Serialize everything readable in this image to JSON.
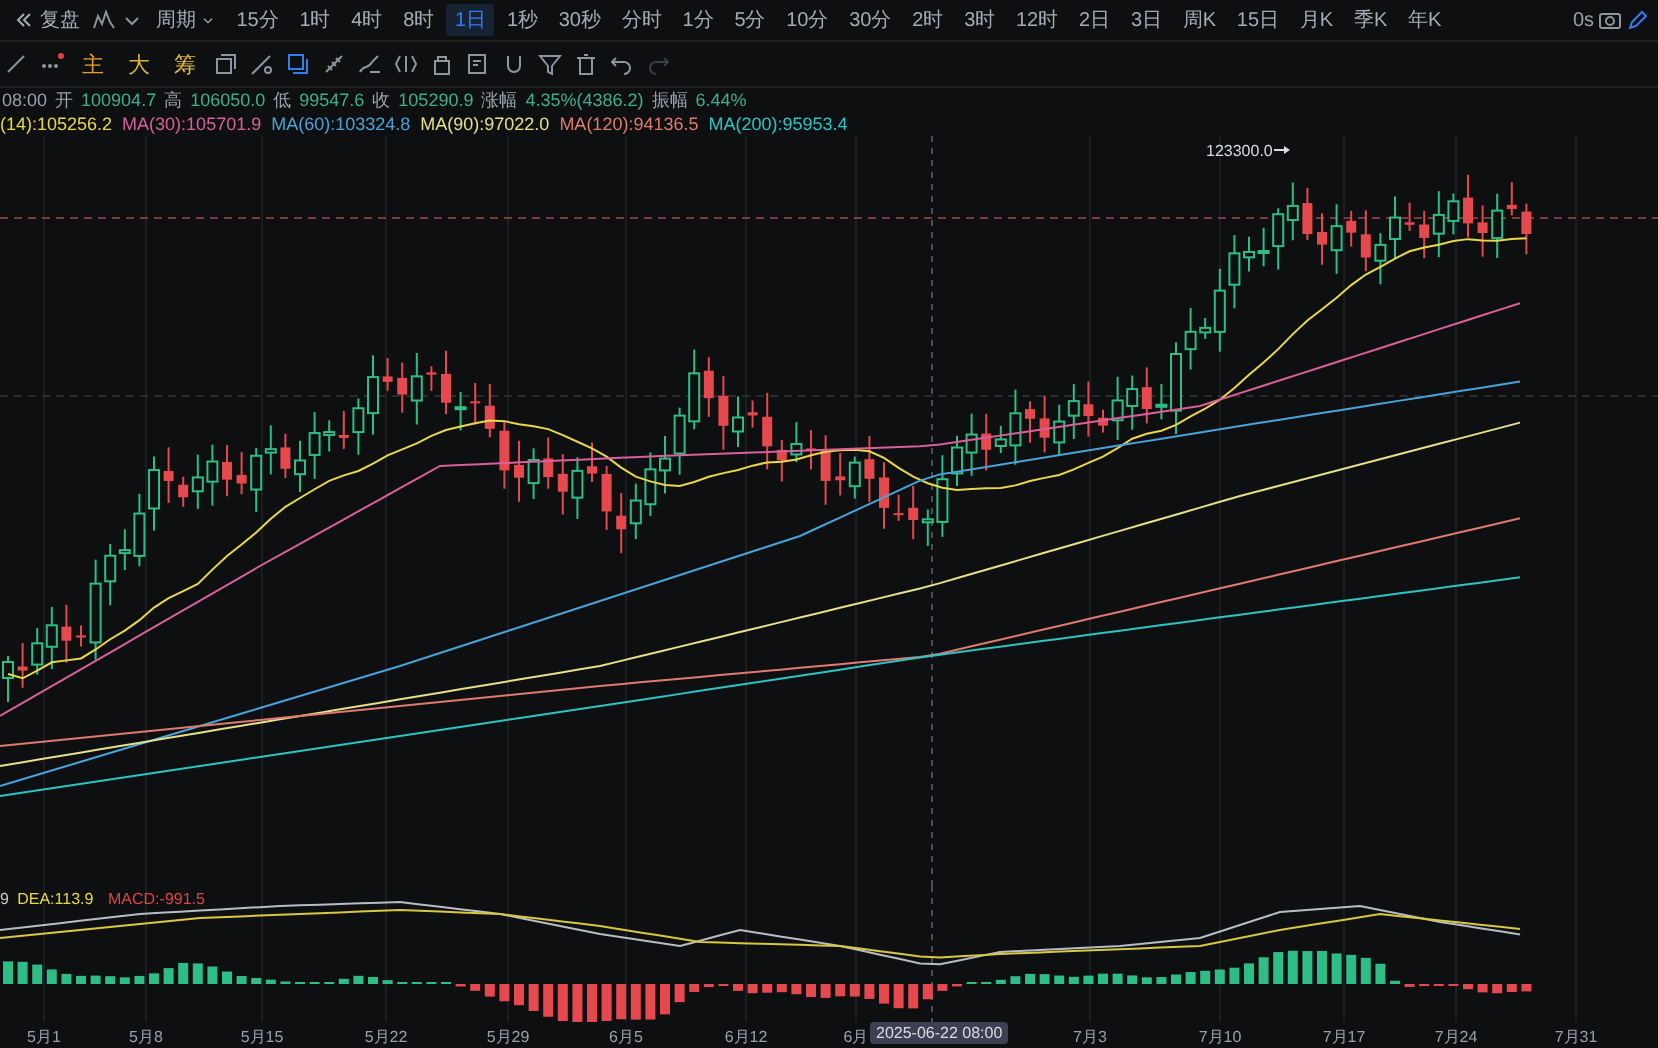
{
  "top_bar": {
    "replay": "复盘",
    "period_menu": "周期",
    "periods": [
      {
        "label": "15分",
        "selected": false
      },
      {
        "label": "1时",
        "selected": false
      },
      {
        "label": "4时",
        "selected": false
      },
      {
        "label": "8时",
        "selected": false
      },
      {
        "label": "1日",
        "selected": true
      },
      {
        "label": "1秒",
        "selected": false
      },
      {
        "label": "30秒",
        "selected": false
      },
      {
        "label": "分时",
        "selected": false
      },
      {
        "label": "1分",
        "selected": false
      },
      {
        "label": "5分",
        "selected": false
      },
      {
        "label": "10分",
        "selected": false
      },
      {
        "label": "30分",
        "selected": false
      },
      {
        "label": "2时",
        "selected": false
      },
      {
        "label": "3时",
        "selected": false
      },
      {
        "label": "12时",
        "selected": false
      },
      {
        "label": "2日",
        "selected": false
      },
      {
        "label": "3日",
        "selected": false
      },
      {
        "label": "周K",
        "selected": false
      },
      {
        "label": "15日",
        "selected": false
      },
      {
        "label": "月K",
        "selected": false
      },
      {
        "label": "季K",
        "selected": false
      },
      {
        "label": "年K",
        "selected": false
      }
    ],
    "latency": "0s"
  },
  "toolbar": {
    "indicators": [
      {
        "label": "主",
        "color": "#e0a030"
      },
      {
        "label": "大",
        "color": "#d9b43a"
      },
      {
        "label": "筹",
        "color": "#e6c23c"
      }
    ]
  },
  "ohlc": {
    "time": "08:00",
    "fields": [
      {
        "label": "开",
        "value": "100904.7"
      },
      {
        "label": "高",
        "value": "106050.0"
      },
      {
        "label": "低",
        "value": "99547.6"
      },
      {
        "label": "收",
        "value": "105290.9"
      },
      {
        "label": "涨幅",
        "value": "4.35%(4386.2)"
      },
      {
        "label": "振幅",
        "value": "6.44%"
      }
    ]
  },
  "moving_averages": [
    {
      "label": "(14):105256.2",
      "color": "#e8d84a"
    },
    {
      "label": "MA(30):105701.9",
      "color": "#d9609a"
    },
    {
      "label": "MA(60):103324.8",
      "color": "#4aa3d8"
    },
    {
      "label": "MA(90):97022.0",
      "color": "#e5e08a"
    },
    {
      "label": "MA(120):94136.5",
      "color": "#e07a70"
    },
    {
      "label": "MA(200):95953.4",
      "color": "#2ec4c4"
    }
  ],
  "high_marker": "123300.0",
  "macd": {
    "labels": [
      {
        "label": "9",
        "color": "#c8c8c8"
      },
      {
        "label": "DEA:113.9",
        "color": "#e8d84a"
      },
      {
        "label": "MACD:-991.5",
        "color": "#d8474a"
      }
    ]
  },
  "date_axis": [
    "5月1",
    "5月8",
    "5月15",
    "5月22",
    "5月29",
    "6月5",
    "6月12",
    "6月",
    "7月3",
    "7月10",
    "7月17",
    "7月24",
    "7月31"
  ],
  "crosshair_time": "2025-06-22 08:00"
}
